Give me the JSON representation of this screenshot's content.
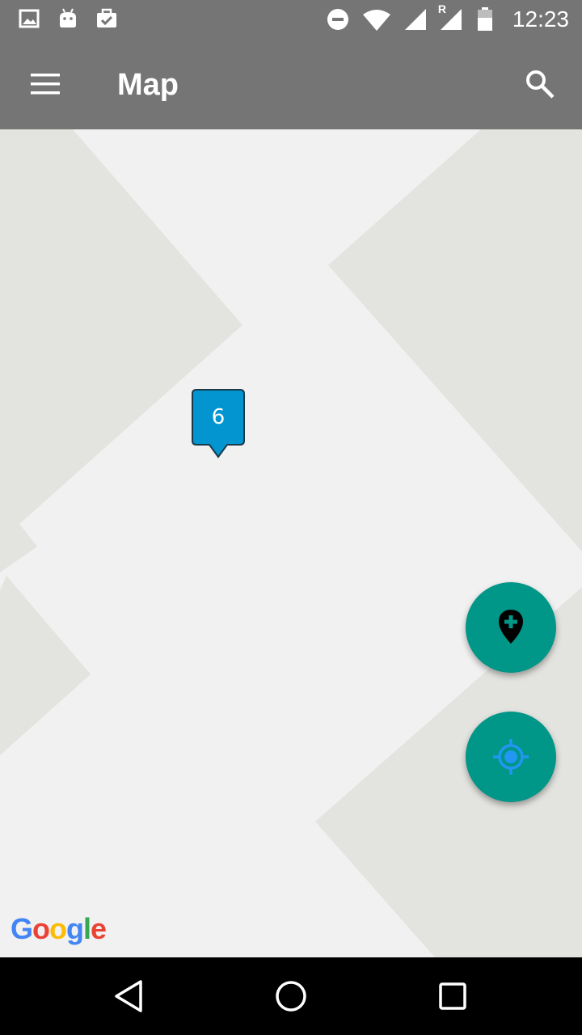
{
  "status_bar": {
    "time": "12:23",
    "left_icons": [
      "image-icon",
      "android-icon",
      "clipboard-check-icon"
    ],
    "right_icons": [
      "do-not-disturb-icon",
      "wifi-icon",
      "signal-icon",
      "roaming-signal-icon",
      "battery-icon"
    ],
    "roaming_label": "R"
  },
  "app_bar": {
    "title": "Map",
    "menu_icon": "menu-icon",
    "search_icon": "search-icon"
  },
  "map": {
    "cluster_count": "6",
    "cluster_color": "#0395d0",
    "attribution": {
      "letters": [
        "G",
        "o",
        "o",
        "g",
        "l",
        "e"
      ],
      "colors": [
        "#4285F4",
        "#EA4335",
        "#FBBC05",
        "#4285F4",
        "#34A853",
        "#EA4335"
      ]
    }
  },
  "fabs": {
    "add_place_icon": "add-location-icon",
    "my_location_icon": "my-location-icon",
    "color": "#009688"
  },
  "nav_bar": {
    "back_icon": "back-triangle-icon",
    "home_icon": "home-circle-icon",
    "recents_icon": "recents-square-icon"
  }
}
